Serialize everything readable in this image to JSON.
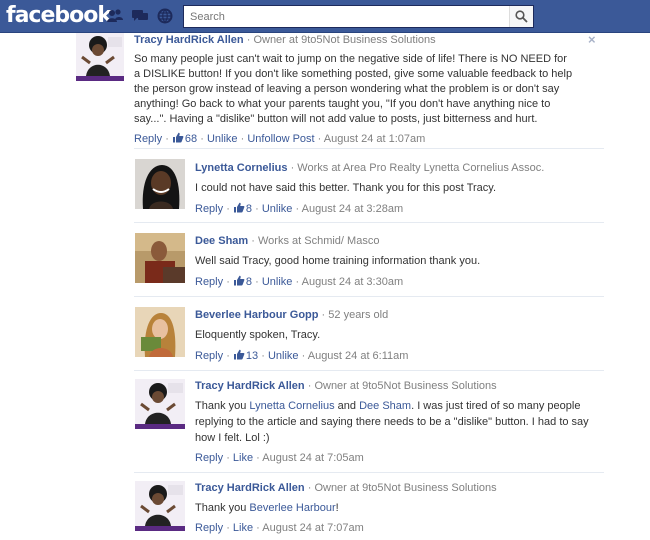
{
  "header": {
    "logo": "facebook",
    "search_placeholder": "Search",
    "icons": [
      "friends-icon",
      "messages-icon",
      "notifications-icon",
      "search-icon"
    ]
  },
  "post": {
    "author": "Tracy HardRick Allen",
    "meta": "Owner at 9to5Not Business Solutions",
    "text": "So many people just can't wait to jump on the negative side of life! There is NO NEED for a DISLIKE button! If you don't like something posted, give some valuable feedback to help the person grow instead of leaving a person wondering what the problem is or don't say anything! Go back to what your parents taught you, \"If you don't have anything nice to say...\". Having a \"dislike\" button will not add value to posts, just bitterness and hurt.",
    "reply_label": "Reply",
    "likes": "68",
    "unlike_label": "Unlike",
    "unfollow_label": "Unfollow Post",
    "time": "August 24 at 1:07am",
    "close_label": "×"
  },
  "comments": [
    {
      "author": "Lynetta Cornelius",
      "meta": "Works at Area Pro Realty Lynetta Cornelius Assoc.",
      "text": "I could not have said this better. Thank you for this post Tracy.",
      "reply_label": "Reply",
      "likes": "8",
      "like_label": "Unlike",
      "time": "August 24 at 3:28am"
    },
    {
      "author": "Dee Sham",
      "meta": "Works at Schmid/ Masco",
      "text": "Well said Tracy, good home training information thank you.",
      "reply_label": "Reply",
      "likes": "8",
      "like_label": "Unlike",
      "time": "August 24 at 3:30am"
    },
    {
      "author": "Beverlee Harbour Gopp",
      "meta": "52 years old",
      "text": "Eloquently spoken, Tracy.",
      "reply_label": "Reply",
      "likes": "13",
      "like_label": "Unlike",
      "time": "August 24 at 6:11am"
    },
    {
      "author": "Tracy HardRick Allen",
      "meta": "Owner at 9to5Not Business Solutions",
      "text_pre": "Thank you ",
      "mention1": "Lynetta Cornelius",
      "text_mid": " and ",
      "mention2": "Dee Sham",
      "text_post": ". I was just tired of so many people replying to the article and saying there needs to be a \"dislike\" button. I had to say how I felt. Lol :)",
      "reply_label": "Reply",
      "like_label": "Like",
      "time": "August 24 at 7:05am"
    },
    {
      "author": "Tracy HardRick Allen",
      "meta": "Owner at 9to5Not Business Solutions",
      "text_pre": "Thank you ",
      "mention1": "Beverlee Harbour",
      "text_post": "!",
      "reply_label": "Reply",
      "like_label": "Like",
      "time": "August 24 at 7:07am"
    }
  ],
  "colors": {
    "brand": "#3b5998",
    "meta_gray": "#808080",
    "divider": "#e5eaf1"
  }
}
